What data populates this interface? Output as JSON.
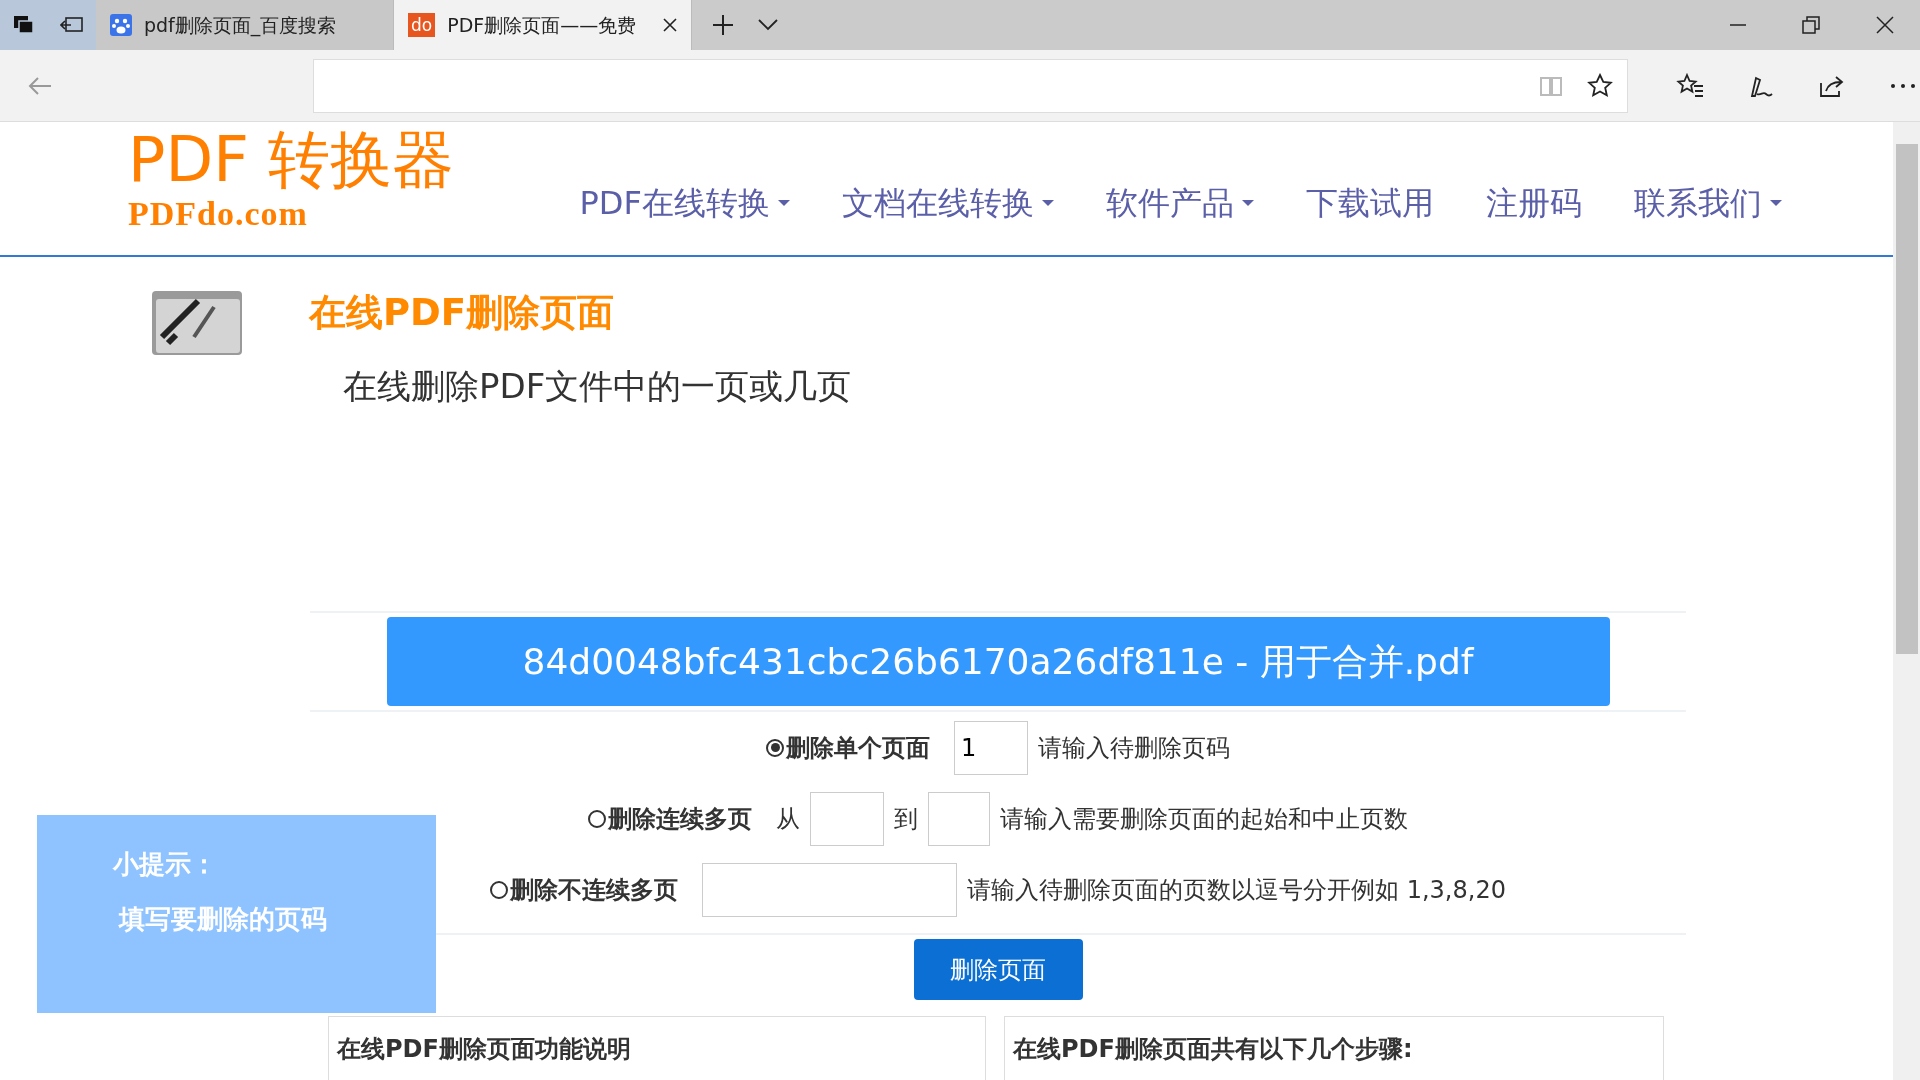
{
  "browser": {
    "tabs": [
      {
        "title": "pdf删除页面_百度搜索",
        "selected": false
      },
      {
        "title": "PDF删除页面——免费",
        "favicon_text": "do",
        "selected": true
      }
    ]
  },
  "header": {
    "logo_title": "PDF 转换器",
    "logo_domain": "PDFdo.com",
    "nav": [
      {
        "label": "PDF在线转换",
        "dropdown": true
      },
      {
        "label": "文档在线转换",
        "dropdown": true
      },
      {
        "label": "软件产品",
        "dropdown": true
      },
      {
        "label": "下载试用",
        "dropdown": false
      },
      {
        "label": "注册码",
        "dropdown": false
      },
      {
        "label": "联系我们",
        "dropdown": true
      }
    ]
  },
  "tool": {
    "title": "在线PDF删除页面",
    "subtitle": "在线删除PDF文件中的一页或几页"
  },
  "file_bar": "84d0048bfc431cbc26b6170a26df811e - 用于合并.pdf",
  "options": [
    {
      "kind": "single",
      "label": "删除单个页面",
      "selected": true,
      "value": "1",
      "hint": "请输入待删除页码"
    },
    {
      "kind": "range",
      "label": "删除连续多页",
      "selected": false,
      "from": "从",
      "to": "到",
      "hint": "请输入需要删除页面的起始和中止页数"
    },
    {
      "kind": "list",
      "label": "删除不连续多页",
      "selected": false,
      "hint": "请输入待删除页面的页数以逗号分开例如 1,3,8,20"
    }
  ],
  "submit": "删除页面",
  "panels": [
    {
      "title": "在线PDF删除页面功能说明"
    },
    {
      "title": "在线PDF删除页面共有以下几个步骤:"
    }
  ],
  "tip": {
    "title": "小提示：",
    "text": "填写要删除的页码"
  }
}
